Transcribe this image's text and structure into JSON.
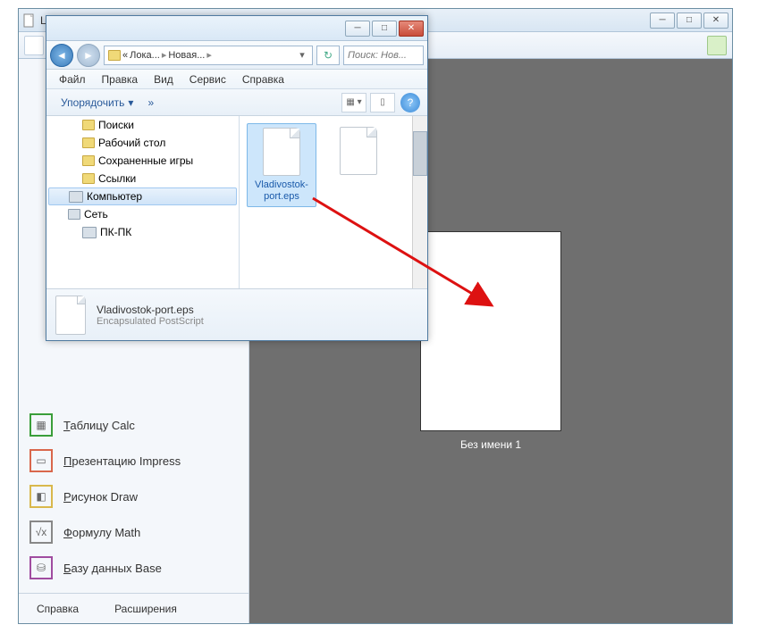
{
  "libreoffice": {
    "title": "LibreOffice",
    "launchers": {
      "calc_prefix": "Т",
      "calc_rest": "аблицу Calc",
      "impress_prefix": "П",
      "impress_rest": "резентацию Impress",
      "draw_prefix": "Р",
      "draw_rest": "исунок Draw",
      "math_prefix": "Ф",
      "math_rest": "ормулу Math",
      "base_prefix": "Б",
      "base_rest": "азу данных Base"
    },
    "footer": {
      "help": "Справка",
      "extensions": "Расширения"
    },
    "doc_label": "Без имени 1"
  },
  "explorer": {
    "breadcrumb": {
      "part1": "Лока...",
      "part2": "Новая...",
      "sep": "▸",
      "left": "«"
    },
    "search_placeholder": "Поиск: Нов...",
    "menu": {
      "file": "Файл",
      "edit": "Правка",
      "view": "Вид",
      "service": "Сервис",
      "help": "Справка"
    },
    "organize": "Упорядочить",
    "more": "»",
    "tree": {
      "searches": "Поиски",
      "desktop": "Рабочий стол",
      "savedgames": "Сохраненные игры",
      "links": "Ссылки",
      "computer": "Компьютер",
      "network": "Сеть",
      "pcpc": "ПК-ПК"
    },
    "files": {
      "selected_name": "Vladivostok-port.eps"
    },
    "details": {
      "name": "Vladivostok-port.eps",
      "type": "Encapsulated PostScript"
    },
    "help_q": "?"
  }
}
